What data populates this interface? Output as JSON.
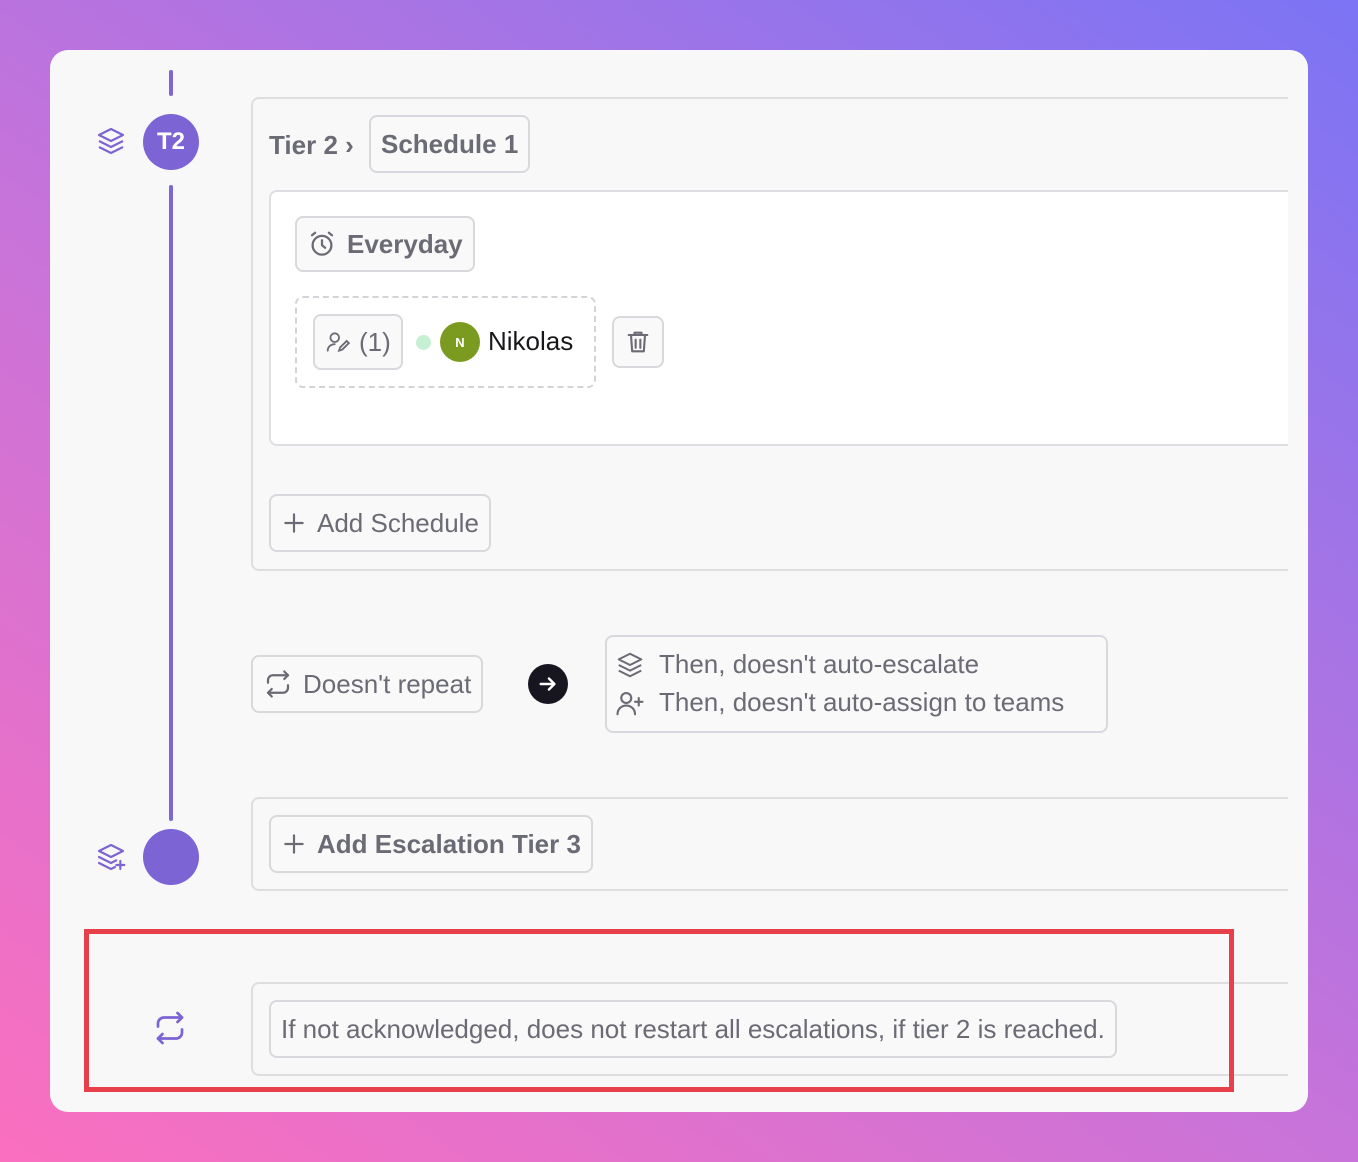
{
  "tier": {
    "badge": "T2",
    "breadcrumb_label": "Tier 2 ›",
    "schedule_name": "Schedule 1"
  },
  "schedule": {
    "time_label": "Everyday",
    "participant_count": "(1)",
    "member_initial": "N",
    "member_name": "Nikolas",
    "add_schedule_label": "Add Schedule"
  },
  "repeat": {
    "label": "Doesn't repeat",
    "then_escalate": "Then, doesn't auto-escalate",
    "then_assign": "Then, doesn't auto-assign to teams"
  },
  "next_tier": {
    "add_label": "Add Escalation Tier 3"
  },
  "restart": {
    "text": "If not acknowledged, does not restart all escalations, if tier 2 is reached."
  },
  "colors": {
    "accent": "#7c64d4",
    "avatar": "#7a9b20",
    "highlight": "#e8404a",
    "online": "#c6f0d3"
  }
}
